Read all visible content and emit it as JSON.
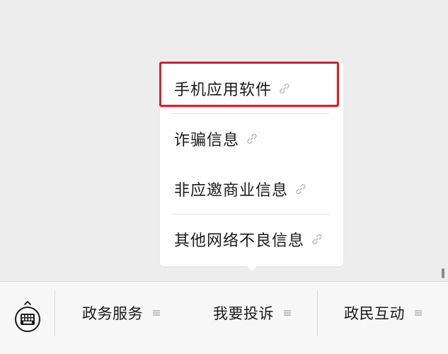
{
  "submenu": {
    "items": [
      {
        "label": "手机应用软件",
        "icon": "link-icon",
        "highlighted": true
      },
      {
        "label": "诈骗信息",
        "icon": "link-icon",
        "highlighted": false
      },
      {
        "label": "非应邀商业信息",
        "icon": "link-icon",
        "highlighted": false
      },
      {
        "label": "其他网络不良信息",
        "icon": "link-icon",
        "highlighted": false
      }
    ]
  },
  "menubar": {
    "keyboard_icon": "keyboard-icon",
    "tabs": [
      {
        "label": "政务服务",
        "icon": "menu-lines-icon"
      },
      {
        "label": "我要投诉",
        "icon": "menu-lines-icon"
      },
      {
        "label": "政民互动",
        "icon": "menu-lines-icon"
      }
    ]
  },
  "colors": {
    "background": "#ededed",
    "popup": "#ffffff",
    "highlight": "#e02020",
    "menubar": "#f7f7f7",
    "text": "#1a1a1a",
    "icon": "#bbbbbb"
  }
}
